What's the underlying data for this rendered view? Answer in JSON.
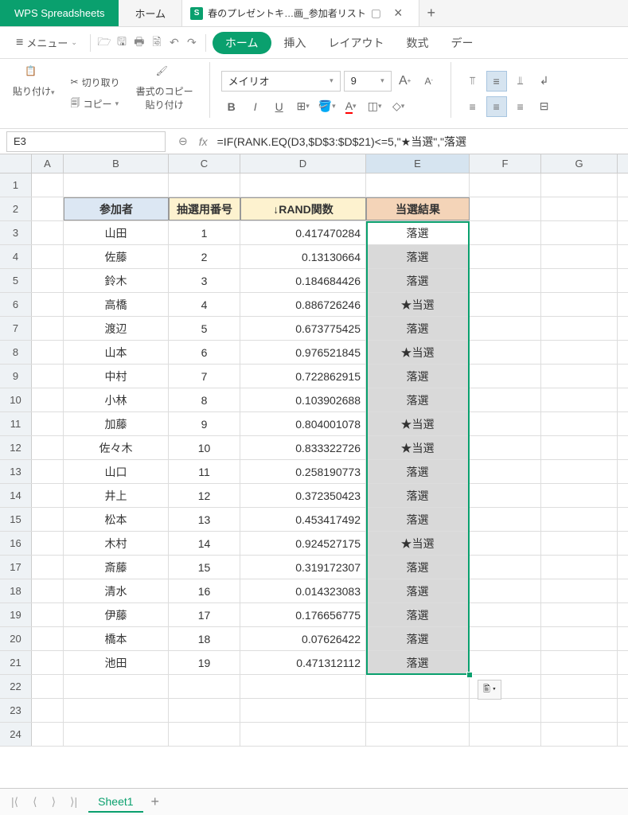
{
  "title_bar": {
    "app_name": "WPS Spreadsheets",
    "tab_home": "ホーム",
    "doc_icon": "S",
    "doc_name": "春のプレゼントキ…画_参加者リスト",
    "pin": "⌂",
    "close": "×",
    "new_tab": "+"
  },
  "menu": {
    "label": "メニュー",
    "ribbon": {
      "home": "ホーム",
      "insert": "挿入",
      "layout": "レイアウト",
      "formula": "数式",
      "data": "デー"
    }
  },
  "toolbar": {
    "paste": "貼り付け",
    "cut": "切り取り",
    "copy": "コピー",
    "format_painter": "書式のコピー\n貼り付け",
    "font_name": "メイリオ",
    "font_size": "9",
    "grow": "A",
    "shrink": "A",
    "bold": "B",
    "italic": "I",
    "underline": "U"
  },
  "formula_bar": {
    "name_box": "E3",
    "fx": "fx",
    "formula": "=IF(RANK.EQ(D3,$D$3:$D$21)<=5,\"★当選\",\"落選"
  },
  "columns": [
    "A",
    "B",
    "C",
    "D",
    "E",
    "F",
    "G"
  ],
  "header_row": {
    "B": "参加者",
    "C": "抽選用番号",
    "D": "↓RAND関数",
    "E": "当選結果"
  },
  "data_rows": [
    {
      "r": 3,
      "B": "山田",
      "C": 1,
      "D": "0.417470284",
      "E": "落選"
    },
    {
      "r": 4,
      "B": "佐藤",
      "C": 2,
      "D": "0.13130664",
      "E": "落選"
    },
    {
      "r": 5,
      "B": "鈴木",
      "C": 3,
      "D": "0.184684426",
      "E": "落選"
    },
    {
      "r": 6,
      "B": "高橋",
      "C": 4,
      "D": "0.886726246",
      "E": "★当選"
    },
    {
      "r": 7,
      "B": "渡辺",
      "C": 5,
      "D": "0.673775425",
      "E": "落選"
    },
    {
      "r": 8,
      "B": "山本",
      "C": 6,
      "D": "0.976521845",
      "E": "★当選"
    },
    {
      "r": 9,
      "B": "中村",
      "C": 7,
      "D": "0.722862915",
      "E": "落選"
    },
    {
      "r": 10,
      "B": "小林",
      "C": 8,
      "D": "0.103902688",
      "E": "落選"
    },
    {
      "r": 11,
      "B": "加藤",
      "C": 9,
      "D": "0.804001078",
      "E": "★当選"
    },
    {
      "r": 12,
      "B": "佐々木",
      "C": 10,
      "D": "0.833322726",
      "E": "★当選"
    },
    {
      "r": 13,
      "B": "山口",
      "C": 11,
      "D": "0.258190773",
      "E": "落選"
    },
    {
      "r": 14,
      "B": "井上",
      "C": 12,
      "D": "0.372350423",
      "E": "落選"
    },
    {
      "r": 15,
      "B": "松本",
      "C": 13,
      "D": "0.453417492",
      "E": "落選"
    },
    {
      "r": 16,
      "B": "木村",
      "C": 14,
      "D": "0.924527175",
      "E": "★当選"
    },
    {
      "r": 17,
      "B": "斎藤",
      "C": 15,
      "D": "0.319172307",
      "E": "落選"
    },
    {
      "r": 18,
      "B": "清水",
      "C": 16,
      "D": "0.014323083",
      "E": "落選"
    },
    {
      "r": 19,
      "B": "伊藤",
      "C": 17,
      "D": "0.176656775",
      "E": "落選"
    },
    {
      "r": 20,
      "B": "橋本",
      "C": 18,
      "D": "0.07626422",
      "E": "落選"
    },
    {
      "r": 21,
      "B": "池田",
      "C": 19,
      "D": "0.471312112",
      "E": "落選"
    }
  ],
  "empty_rows": [
    22,
    23,
    24
  ],
  "paste_options": "🖺 ▾",
  "sheets": {
    "active": "Sheet1",
    "add": "+"
  }
}
